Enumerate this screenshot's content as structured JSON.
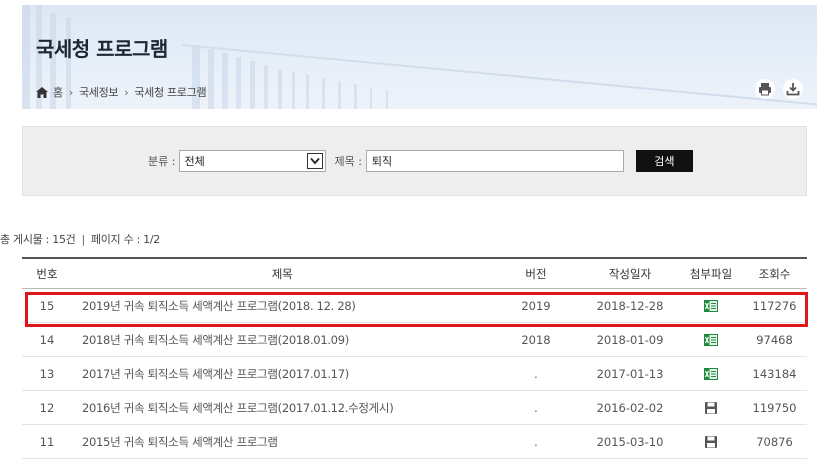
{
  "header": {
    "title": "국세청 프로그램",
    "breadcrumb": [
      "홈",
      "국세정보",
      "국세청 프로그램"
    ]
  },
  "icons": {
    "home": "home-icon",
    "print": "print-icon",
    "download": "download-icon",
    "excel": "excel-file-icon",
    "disk": "save-disk-icon"
  },
  "search": {
    "category_label": "분류 :",
    "category_value": "전체",
    "title_label": "제목 :",
    "title_value": "퇴직",
    "button": "검색"
  },
  "summary": {
    "total": "총 게시물 : 15건",
    "pages": "페이지 수 : 1/2"
  },
  "table": {
    "columns": [
      "번호",
      "제목",
      "버전",
      "작성일자",
      "첨부파일",
      "조회수"
    ],
    "rows": [
      {
        "no": "15",
        "title": "2019년 귀속 퇴직소득 세액계산 프로그램(2018. 12. 28)",
        "version": "2019",
        "date": "2018-12-28",
        "file": "excel",
        "views": "117276"
      },
      {
        "no": "14",
        "title": "2018년 귀속 퇴직소득 세액계산 프로그램(2018.01.09)",
        "version": "2018",
        "date": "2018-01-09",
        "file": "excel",
        "views": "97468"
      },
      {
        "no": "13",
        "title": "2017년 귀속 퇴직소득 세액계산 프로그램(2017.01.17)",
        "version": ".",
        "date": "2017-01-13",
        "file": "excel",
        "views": "143184"
      },
      {
        "no": "12",
        "title": "2016년 귀속 퇴직소득 세액계산 프로그램(2017.01.12.수정게시)",
        "version": ".",
        "date": "2016-02-02",
        "file": "disk",
        "views": "119750"
      },
      {
        "no": "11",
        "title": "2015년 귀속 퇴직소득 세액계산 프로그램",
        "version": ".",
        "date": "2015-03-10",
        "file": "disk",
        "views": "70876"
      }
    ]
  },
  "colors": {
    "highlight": "#e0161b",
    "banner": "#e3ebf6",
    "search_bg": "#eeeeee",
    "excel_green": "#1e8a3c"
  }
}
